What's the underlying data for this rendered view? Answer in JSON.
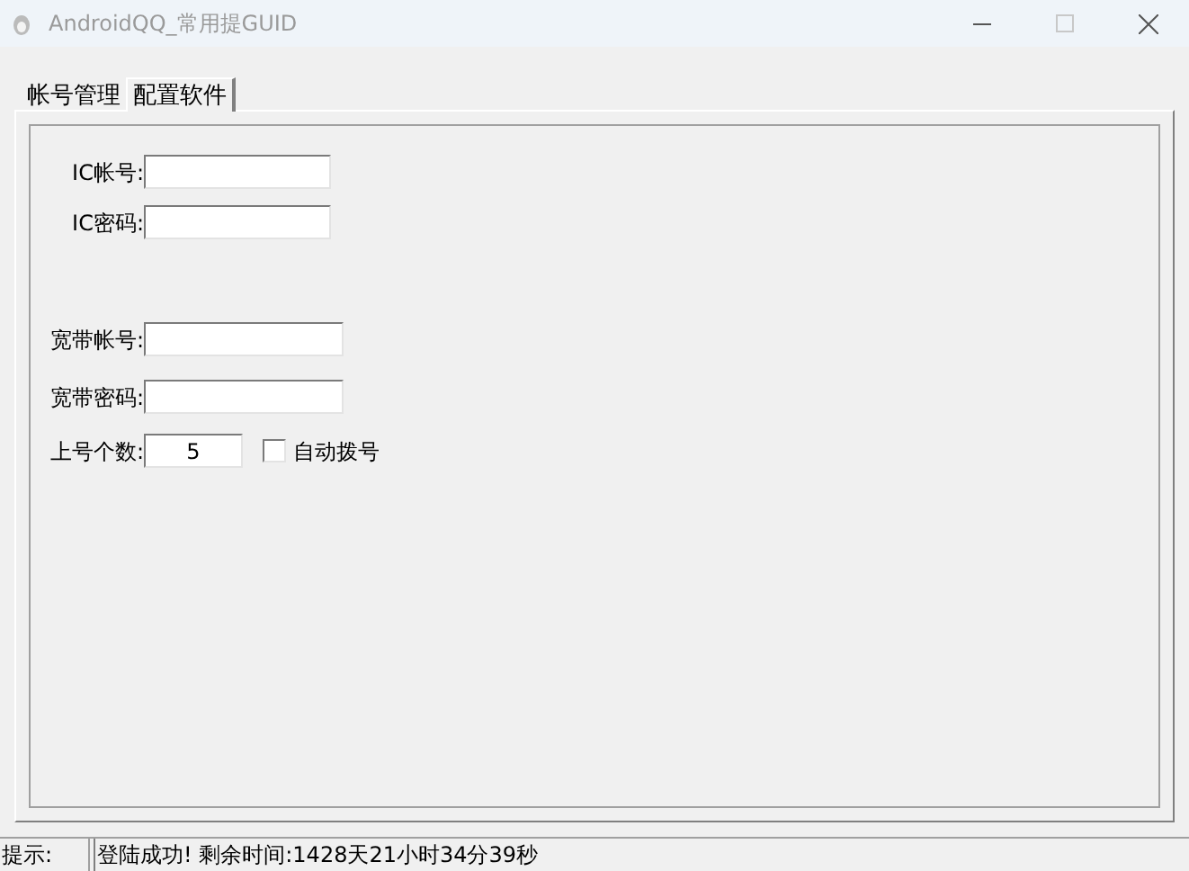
{
  "window": {
    "title": "AndroidQQ_常用提GUID"
  },
  "tabs": [
    {
      "label": "帐号管理",
      "selected": false
    },
    {
      "label": "配置软件",
      "selected": true
    }
  ],
  "fields": [
    {
      "label": "IC帐号:"
    },
    {
      "label": "IC密码:"
    },
    {
      "label": "宽带帐号:"
    },
    {
      "label": "宽带密码:"
    },
    {
      "label": "上号个数:",
      "value": "5"
    }
  ],
  "auto_dial": {
    "label": "自动拨号",
    "checked": false
  },
  "status_bar": {
    "label": "提示:",
    "message": "登陆成功! 剩余时间:1428天21小时34分39秒"
  }
}
